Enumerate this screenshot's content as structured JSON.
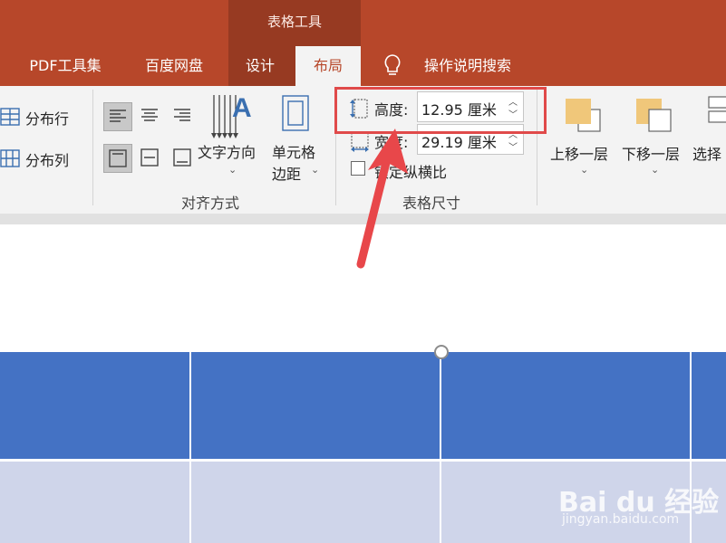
{
  "ribbon": {
    "context_title": "表格工具",
    "tabs": [
      {
        "label": "PDF工具集"
      },
      {
        "label": "百度网盘"
      },
      {
        "label": "设计"
      },
      {
        "label": "布局"
      }
    ],
    "tell_me": "操作说明搜索"
  },
  "distribute": {
    "rows": "分布行",
    "cols": "分布列"
  },
  "alignment": {
    "group_label": "对齐方式",
    "text_direction": "文字方向",
    "cell_margins_line1": "单元格",
    "cell_margins_line2": "边距"
  },
  "table_size": {
    "group_label": "表格尺寸",
    "height_label": "高度:",
    "height_value": "12.95 厘米",
    "width_label": "宽度:",
    "width_value": "29.19 厘米",
    "lock_ratio": "锁定纵横比"
  },
  "arrange": {
    "bring_forward": "上移一层",
    "send_backward": "下移一层",
    "selection_pane": "选择"
  },
  "watermark": {
    "brand": "Bai du 经验",
    "url": "jingyan.baidu.com"
  },
  "colors": {
    "ribbon_red": "#b7472a",
    "context_red": "#973a22",
    "table_header_blue": "#4472c4",
    "table_body_lavender": "#cfd5ea",
    "highlight_red": "#e04a4a",
    "arrow_red": "#e8474a"
  }
}
